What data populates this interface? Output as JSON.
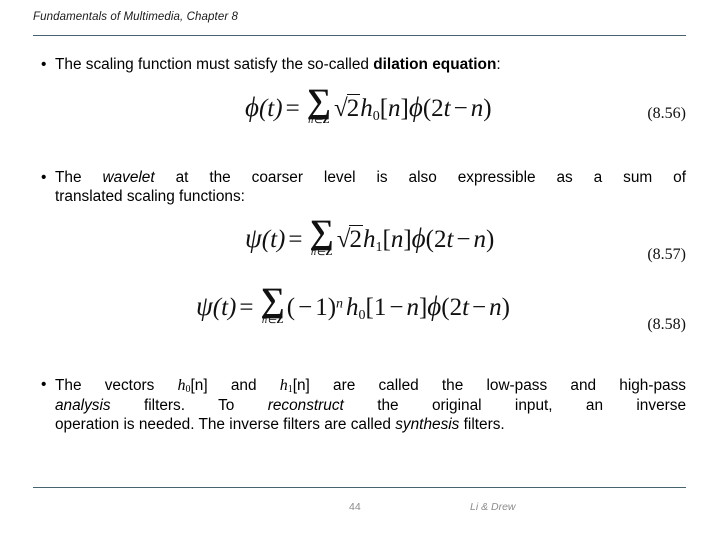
{
  "header": {
    "title": "Fundamentals of Multimedia, Chapter 8"
  },
  "bullets": {
    "b1": {
      "marker": "•",
      "text_pre": "The scaling function must satisfy the so-called ",
      "emphasis": "dilation equation",
      "text_post": ":"
    },
    "b2": {
      "marker": "•",
      "text_pre": "The ",
      "emphasis": "wavelet",
      "text_post": " at the coarser level is also expressible as a sum of",
      "line2": "translated scaling functions:"
    },
    "b3": {
      "marker": "•",
      "seg1": "The vectors ",
      "var1": "h",
      "var1_sub": "0",
      "var1_brk": "[n]",
      "seg2": " and ",
      "var2": "h",
      "var2_sub": "1",
      "var2_brk": "[n]",
      "seg3": " are called the low-pass and high-pass",
      "seg4_em": "analysis",
      "seg5": " filters. To ",
      "seg6_em": "reconstruct",
      "seg7": " the original input, an inverse",
      "seg8": "operation is needed. The inverse filters are called ",
      "seg9_em": "synthesis",
      "seg10": " filters."
    }
  },
  "equations": [
    {
      "id": "eq-8-56",
      "lhs_fn": "ϕ",
      "lhs_arg": "(t)",
      "equals": "=",
      "sum_symbol": "∑",
      "sum_limit": "n∈",
      "sum_limit_set": "Z",
      "radical": "√",
      "radicand": "2",
      "coef_var": "h",
      "coef_sub": "0",
      "coef_brk_open": "[",
      "coef_index": "n",
      "coef_brk_close": "]",
      "fn2": "ϕ",
      "fn2_arg_open": "(2",
      "fn2_arg_t": "t",
      "fn2_minus": "−",
      "fn2_n": "n",
      "fn2_close": ")",
      "number": "(8.56)"
    },
    {
      "id": "eq-8-57",
      "lhs_fn": "ψ",
      "lhs_arg": "(t)",
      "equals": "=",
      "sum_symbol": "∑",
      "sum_limit": "n∈",
      "sum_limit_set": "Z",
      "radical": "√",
      "radicand": "2",
      "coef_var": "h",
      "coef_sub": "1",
      "coef_brk_open": "[",
      "coef_index": "n",
      "coef_brk_close": "]",
      "fn2": "ϕ",
      "fn2_arg_open": "(2",
      "fn2_arg_t": "t",
      "fn2_minus": "−",
      "fn2_n": "n",
      "fn2_close": ")",
      "number": "(8.57)"
    },
    {
      "id": "eq-8-58",
      "lhs_fn": "ψ",
      "lhs_arg": "(t)",
      "equals": "=",
      "sum_symbol": "∑",
      "sum_limit": "n∈",
      "sum_limit_set": "Z",
      "sign_open": "(",
      "sign_minus": "−",
      "sign_one": "1)",
      "sign_exp": "n",
      "coef_var": "h",
      "coef_sub": "0",
      "coef_brk_open": "[1",
      "coef_minus": "−",
      "coef_index": "n",
      "coef_brk_close": "]",
      "fn2": "ϕ",
      "fn2_arg_open": "(2",
      "fn2_arg_t": "t",
      "fn2_minus": "−",
      "fn2_n": "n",
      "fn2_close": ")",
      "number": "(8.58)"
    }
  ],
  "footer": {
    "page_number": "44",
    "credit": "Li & Drew"
  },
  "colors": {
    "rule": "#47636f",
    "text": "#000000",
    "footer_text": "#8b8b8b",
    "background": "#ffffff"
  }
}
